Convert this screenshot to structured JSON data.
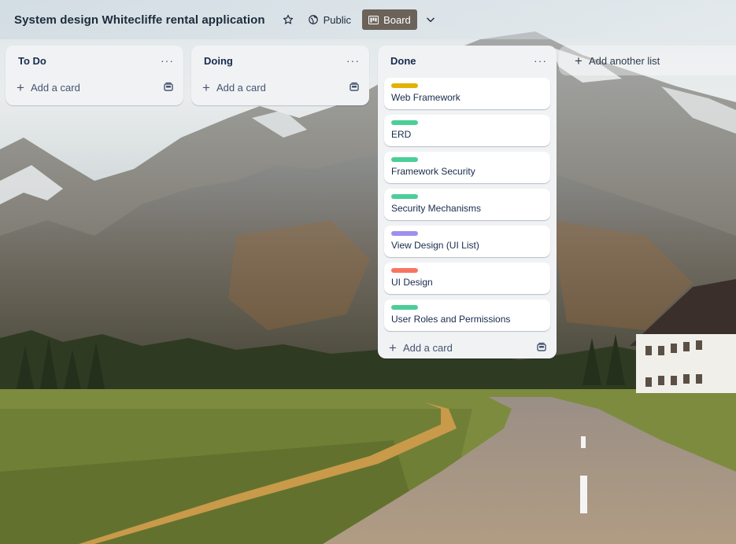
{
  "board": {
    "title": "System design Whitecliffe rental application",
    "visibility": "Public",
    "view": "Board"
  },
  "colors": {
    "yellow": "#e2b203",
    "green": "#4bce97",
    "purple": "#9f8fef",
    "red": "#f87462",
    "board_button": "#6b625a"
  },
  "lists": [
    {
      "title": "To Do",
      "menu": "···",
      "add_card": "Add a card",
      "cards": []
    },
    {
      "title": "Doing",
      "menu": "···",
      "add_card": "Add a card",
      "cards": []
    },
    {
      "title": "Done",
      "menu": "···",
      "add_card": "Add a card",
      "cards": [
        {
          "title": "Web Framework",
          "label_color": "yellow"
        },
        {
          "title": "ERD",
          "label_color": "green"
        },
        {
          "title": "Framework Security",
          "label_color": "green"
        },
        {
          "title": "Security Mechanisms",
          "label_color": "green"
        },
        {
          "title": "View Design (UI List)",
          "label_color": "purple"
        },
        {
          "title": "UI Design",
          "label_color": "red"
        },
        {
          "title": "User Roles and Permissions",
          "label_color": "green"
        }
      ]
    }
  ],
  "add_list": "Add another list",
  "icons": {
    "star": "star-icon",
    "public": "globe-icon",
    "board": "board-icon",
    "chevron": "chevron-down-icon",
    "template": "card-template-icon",
    "plus": "plus-icon"
  }
}
